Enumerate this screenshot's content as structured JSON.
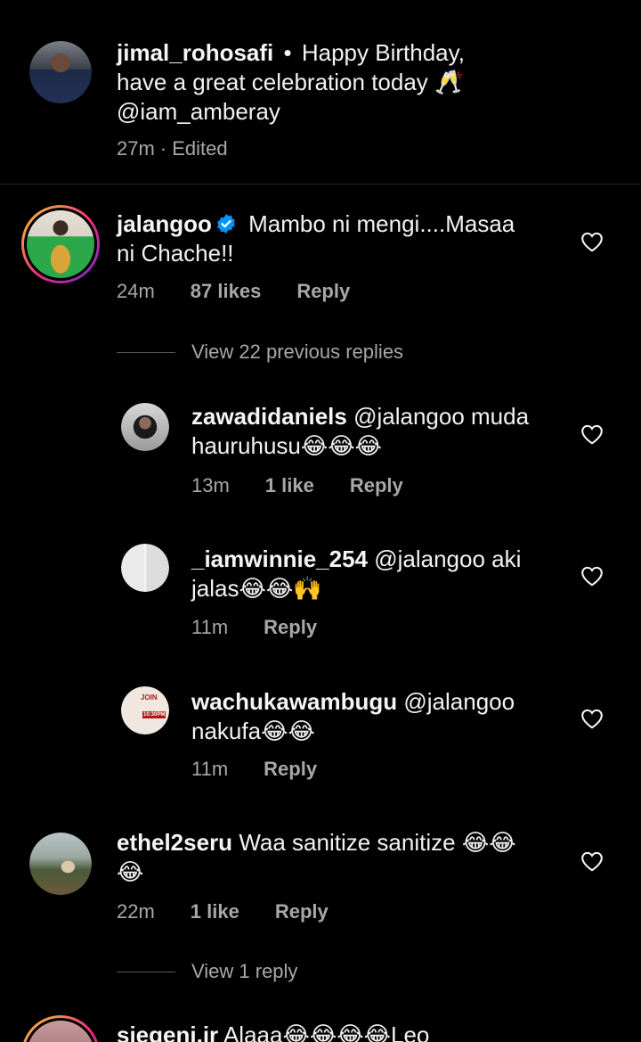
{
  "comments": [
    {
      "username": "jimal_rohosafi",
      "separator": "•",
      "text_line1": "Happy Birthday,",
      "text_line2": "have a great celebration today 🥂",
      "text_line3": "@iam_amberay",
      "time": "27m",
      "edited": "· Edited"
    },
    {
      "username": "jalangoo",
      "text_line1": "Mambo ni mengi....Masaa",
      "text_line2": "ni Chache!!",
      "time": "24m",
      "likes": "87 likes",
      "reply": "Reply",
      "view_replies": "View 22 previous replies"
    },
    {
      "username": "zawadidaniels",
      "text_line1": "@jalangoo muda",
      "text_line2": "hauruhusu",
      "emojis": "😂😂😂",
      "time": "13m",
      "likes": "1 like",
      "reply": "Reply"
    },
    {
      "username": "_iamwinnie_254",
      "text_line1": "@jalangoo aki",
      "text_line2": "jalas",
      "emojis": "😂😂🙌",
      "time": "11m",
      "reply": "Reply"
    },
    {
      "username": "wachukawambugu",
      "text_line1": "@jalangoo",
      "text_line2": "nakufa",
      "emojis": "😂😂",
      "time": "11m",
      "reply": "Reply",
      "avatar_text_1": "JOIN",
      "avatar_text_2": "10:30PM"
    },
    {
      "username": "ethel2seru",
      "text_line1": "Waa sanitize sanitize",
      "emojis_line1": "😂😂",
      "emojis_line2": "😂",
      "time": "22m",
      "likes": "1 like",
      "reply": "Reply",
      "view_replies": "View 1 reply"
    },
    {
      "username": "sjegeni.jr",
      "text_line1": "Alaaa",
      "emojis": "😂😂😂😂",
      "text_after": "Leo"
    }
  ],
  "colors": {
    "background": "#000000",
    "text": "#f5f5f5",
    "secondary": "#a8a8a8",
    "verified": "#0095f6",
    "divider": "#262626"
  }
}
